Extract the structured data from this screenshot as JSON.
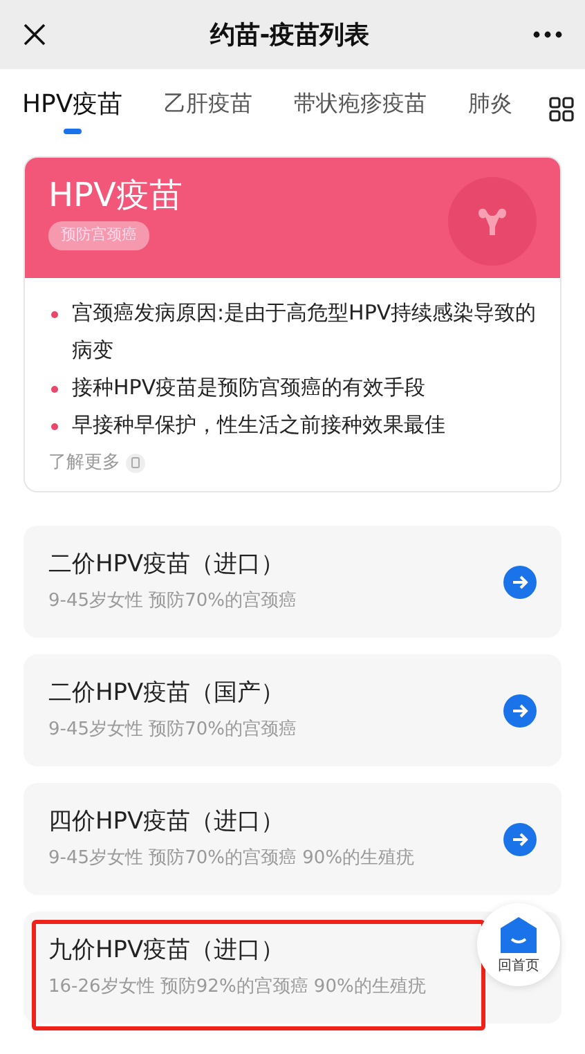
{
  "window": {
    "title": "约苗-疫苗列表"
  },
  "tabs": [
    {
      "label": "HPV疫苗",
      "selected": true
    },
    {
      "label": "乙肝疫苗",
      "selected": false
    },
    {
      "label": "带状疱疹疫苗",
      "selected": false
    },
    {
      "label": "肺炎",
      "selected": false
    }
  ],
  "intro": {
    "title": "HPV疫苗",
    "tag": "预防宫颈癌",
    "points": [
      "宫颈癌发病原因:是由于高危型HPV持续感染导致的病变",
      "接种HPV疫苗是预防宫颈癌的有效手段",
      "早接种早保护，性生活之前接种效果最佳"
    ],
    "more": "了解更多"
  },
  "vaccines": [
    {
      "name": "二价HPV疫苗（进口）",
      "desc": "9-45岁女性 预防70%的宫颈癌",
      "highlighted": false
    },
    {
      "name": "二价HPV疫苗（国产）",
      "desc": "9-45岁女性 预防70%的宫颈癌",
      "highlighted": false
    },
    {
      "name": "四价HPV疫苗（进口）",
      "desc": "9-45岁女性 预防70%的宫颈癌 90%的生殖疣",
      "highlighted": false
    },
    {
      "name": "九价HPV疫苗（进口）",
      "desc": "16-26岁女性 预防92%的宫颈癌 90%的生殖疣",
      "highlighted": true
    }
  ],
  "home_button": {
    "label": "回首页"
  }
}
